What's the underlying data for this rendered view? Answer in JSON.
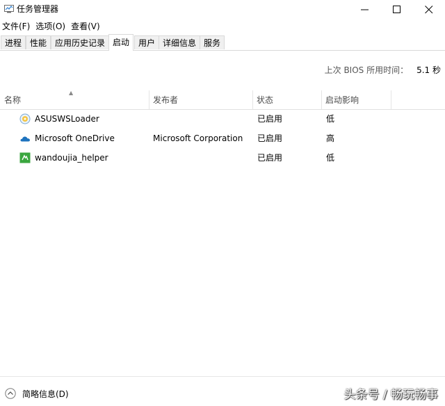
{
  "window": {
    "title": "任务管理器"
  },
  "menu": {
    "items": [
      "文件(F)",
      "选项(O)",
      "查看(V)"
    ]
  },
  "tabs": {
    "items": [
      "进程",
      "性能",
      "应用历史记录",
      "启动",
      "用户",
      "详细信息",
      "服务"
    ],
    "active": "启动"
  },
  "boot": {
    "label": "上次 BIOS 所用时间：",
    "value": "5.1 秒"
  },
  "table": {
    "columns": [
      "名称",
      "发布者",
      "状态",
      "启动影响"
    ],
    "rows": [
      {
        "icon": "asus-loader-icon",
        "name": "ASUSWSLoader",
        "publisher": "",
        "status": "已启用",
        "impact": "低"
      },
      {
        "icon": "onedrive-cloud-icon",
        "name": "Microsoft OneDrive",
        "publisher": "Microsoft Corporation",
        "status": "已启用",
        "impact": "高"
      },
      {
        "icon": "wandoujia-icon",
        "name": "wandoujia_helper",
        "publisher": "",
        "status": "已启用",
        "impact": "低"
      }
    ]
  },
  "footer": {
    "fewer_details": "简略信息(D)",
    "watermark": "头条号 / 畅玩畅事"
  },
  "colors": {
    "accent_blue": "#1e73be",
    "wandoujia_green": "#3aa63f",
    "border": "#d9d9d9"
  }
}
